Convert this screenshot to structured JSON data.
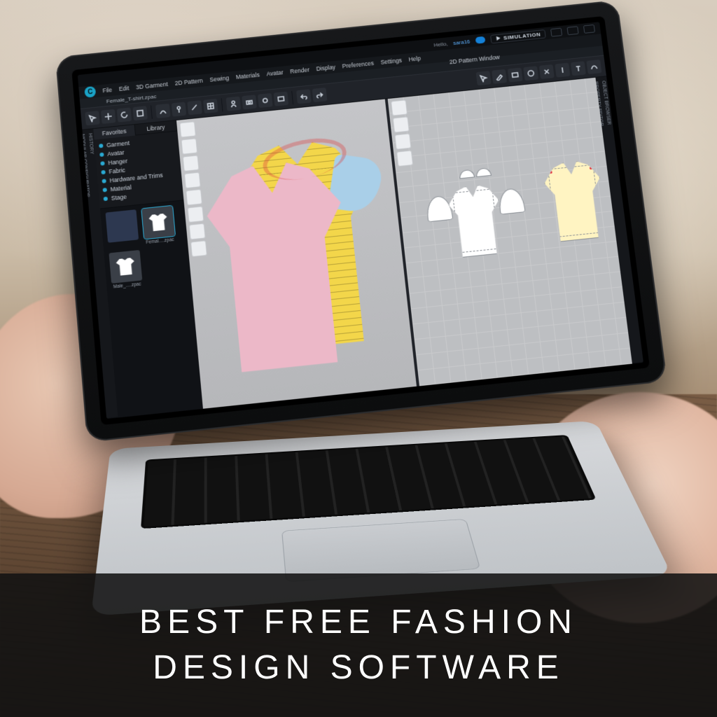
{
  "banner": {
    "line1": "BEST FREE FASHION",
    "line2": "DESIGN SOFTWARE"
  },
  "titlebar": {
    "hello": "Hello,",
    "user": "sara16",
    "simulation": "SIMULATION",
    "pattern_window": "2D Pattern Window"
  },
  "menu": [
    "File",
    "Edit",
    "3D Garment",
    "2D Pattern",
    "Sewing",
    "Materials",
    "Avatar",
    "Render",
    "Display",
    "Preferences",
    "Settings",
    "Help"
  ],
  "open_file": "Female_T-shirt.zpac",
  "sidebar": {
    "tabs": {
      "favorites": "Favorites",
      "library": "Library"
    },
    "items": [
      {
        "label": "Garment"
      },
      {
        "label": "Avatar"
      },
      {
        "label": "Hanger"
      },
      {
        "label": "Fabric"
      },
      {
        "label": "Hardware and Trims"
      },
      {
        "label": "Material"
      },
      {
        "label": "Stage"
      }
    ],
    "thumbs": [
      {
        "label": "Femal….zpac",
        "selected": true
      },
      {
        "label": "Male_….zpac",
        "selected": false
      }
    ],
    "extra_thumb": {
      "label": ""
    }
  },
  "left_tabs": [
    "HISTORY",
    "MODULAR CONFIGURATOR"
  ],
  "right_tabs": [
    "OBJECT BROWSER",
    "PROPERTY EDITOR"
  ],
  "logo_letter": "C"
}
